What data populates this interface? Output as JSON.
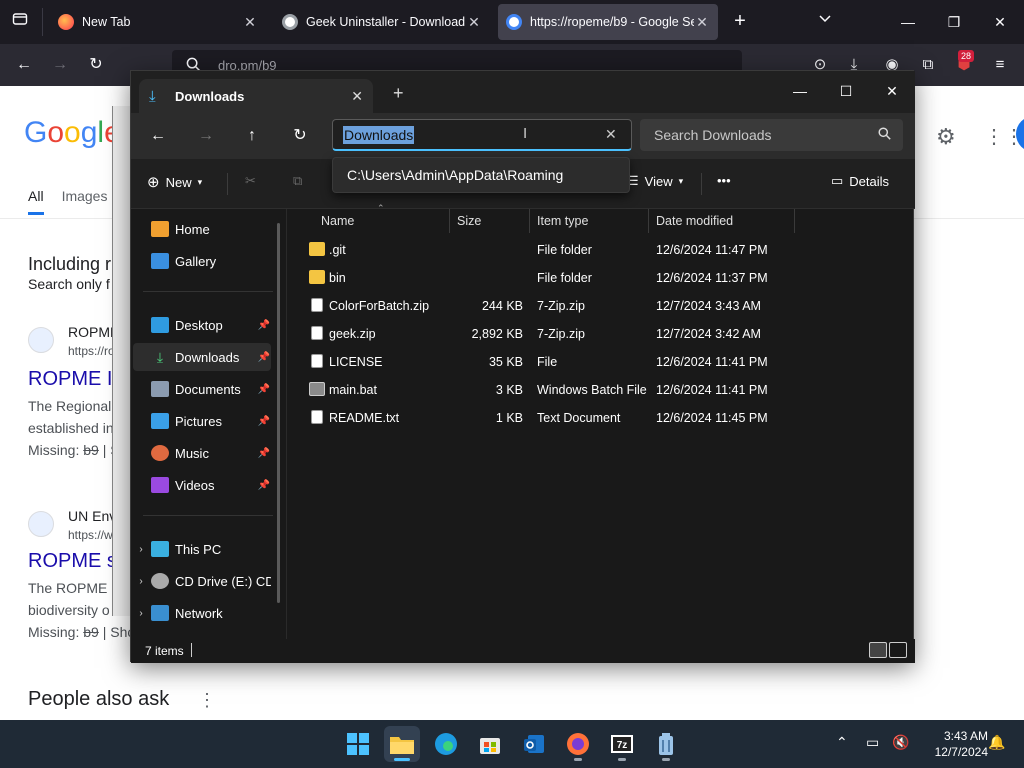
{
  "browser": {
    "tabs": [
      {
        "title": "New Tab",
        "favicon_color": "#ff7139",
        "active": false
      },
      {
        "title": "Geek Uninstaller - Download",
        "favicon_color": "#9aa0a6",
        "active": false
      },
      {
        "title": "https://ropeme/b9 - Google Se",
        "favicon_color": "#4285f4",
        "active": true
      }
    ],
    "url": "dro.pm/b9",
    "extension_badge": "28"
  },
  "google": {
    "logo": "Google",
    "tabs": [
      "All",
      "Images"
    ],
    "including_heading": "Including r",
    "search_only": "Search only f",
    "results": [
      {
        "site": "ROPME",
        "url": "https://ro",
        "title": "ROPME I",
        "snippet1": "The Regional",
        "snippet2": "established in",
        "missing": "Missing:",
        "missing_term": "b9",
        "missing_tail": "| S"
      },
      {
        "site": "UN Env",
        "url": "https://w",
        "title": "ROPME s",
        "snippet1": "The ROPME",
        "snippet2": "biodiversity o",
        "missing": "Missing:",
        "missing_term": "b9",
        "missing_tail": "| Sho"
      }
    ],
    "people_also_ask": "People also ask"
  },
  "explorer": {
    "tab_title": "Downloads",
    "address": "Downloads",
    "search_placeholder": "Search Downloads",
    "suggestion": "C:\\Users\\Admin\\AppData\\Roaming",
    "cmd": {
      "new": "New",
      "view": "View",
      "more": "•••",
      "details": "Details"
    },
    "nav": {
      "home": "Home",
      "gallery": "Gallery",
      "desktop": "Desktop",
      "downloads": "Downloads",
      "documents": "Documents",
      "pictures": "Pictures",
      "music": "Music",
      "videos": "Videos",
      "this_pc": "This PC",
      "cd_drive": "CD Drive (E:) CD",
      "network": "Network"
    },
    "columns": {
      "name": "Name",
      "size": "Size",
      "type": "Item type",
      "date": "Date modified"
    },
    "files": [
      {
        "name": ".git",
        "size": "",
        "type": "File folder",
        "date": "12/6/2024 11:47 PM",
        "icon": "folder-icon",
        "color": "#f4c542"
      },
      {
        "name": "bin",
        "size": "",
        "type": "File folder",
        "date": "12/6/2024 11:37 PM",
        "icon": "folder-icon",
        "color": "#f4c542"
      },
      {
        "name": "ColorForBatch.zip",
        "size": "244 KB",
        "type": "7-Zip.zip",
        "date": "12/7/2024 3:43 AM",
        "icon": "file-icon",
        "color": "#d8d8d8"
      },
      {
        "name": "geek.zip",
        "size": "2,892 KB",
        "type": "7-Zip.zip",
        "date": "12/7/2024 3:42 AM",
        "icon": "file-icon",
        "color": "#d8d8d8"
      },
      {
        "name": "LICENSE",
        "size": "35 KB",
        "type": "File",
        "date": "12/6/2024 11:41 PM",
        "icon": "file-icon",
        "color": "#d8d8d8"
      },
      {
        "name": "main.bat",
        "size": "3 KB",
        "type": "Windows Batch File",
        "date": "12/6/2024 11:41 PM",
        "icon": "batch-file-icon",
        "color": "#8a8a8a"
      },
      {
        "name": "README.txt",
        "size": "1 KB",
        "type": "Text Document",
        "date": "12/6/2024 11:45 PM",
        "icon": "text-file-icon",
        "color": "#d8d8d8"
      }
    ],
    "status": "7 items"
  },
  "taskbar": {
    "time": "3:43 AM",
    "date": "12/7/2024"
  }
}
